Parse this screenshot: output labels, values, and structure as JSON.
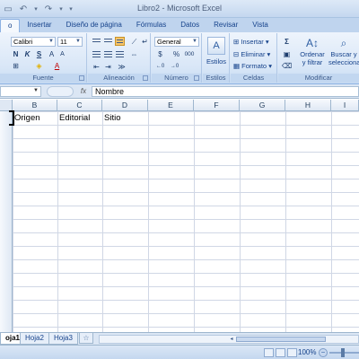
{
  "window": {
    "title": "Libro2 - Microsoft Excel"
  },
  "qat": {
    "save_icon": "save-icon",
    "undo_icon": "undo-icon",
    "redo_icon": "redo-icon"
  },
  "ribbon_tabs": [
    "o",
    "Insertar",
    "Diseño de página",
    "Fórmulas",
    "Datos",
    "Revisar",
    "Vista"
  ],
  "ribbon": {
    "fuente": {
      "label": "Fuente",
      "font_name": "Calibri",
      "font_size": "11"
    },
    "alineacion": {
      "label": "Alineación"
    },
    "numero": {
      "label": "Número",
      "format": "General",
      "currency": "$",
      "percent": "%",
      "thousands": "000"
    },
    "estilos": {
      "label": "Estilos"
    },
    "celdas": {
      "label": "Celdas",
      "insertar": "Insertar",
      "eliminar": "Eliminar",
      "formato": "Formato"
    },
    "modificar": {
      "label": "Modificar",
      "ordenar_1": "Ordenar",
      "ordenar_2": "y filtrar",
      "buscar_1": "Buscar y",
      "buscar_2": "seleccionar"
    }
  },
  "formula_bar": {
    "name_box": "",
    "fx": "fx",
    "value": "Nombre"
  },
  "columns": [
    "B",
    "C",
    "D",
    "E",
    "F",
    "G",
    "H",
    "I"
  ],
  "cells": {
    "B1": "Origen",
    "C1": "Editorial",
    "D1": "Sitio"
  },
  "sheets": [
    "oja1",
    "Hoja2",
    "Hoja3"
  ],
  "status": {
    "zoom": "100%"
  },
  "colors": {
    "ribbon_bg": "#dbe7f6",
    "accent": "#15428b",
    "selected_button": "#f7c56b"
  }
}
